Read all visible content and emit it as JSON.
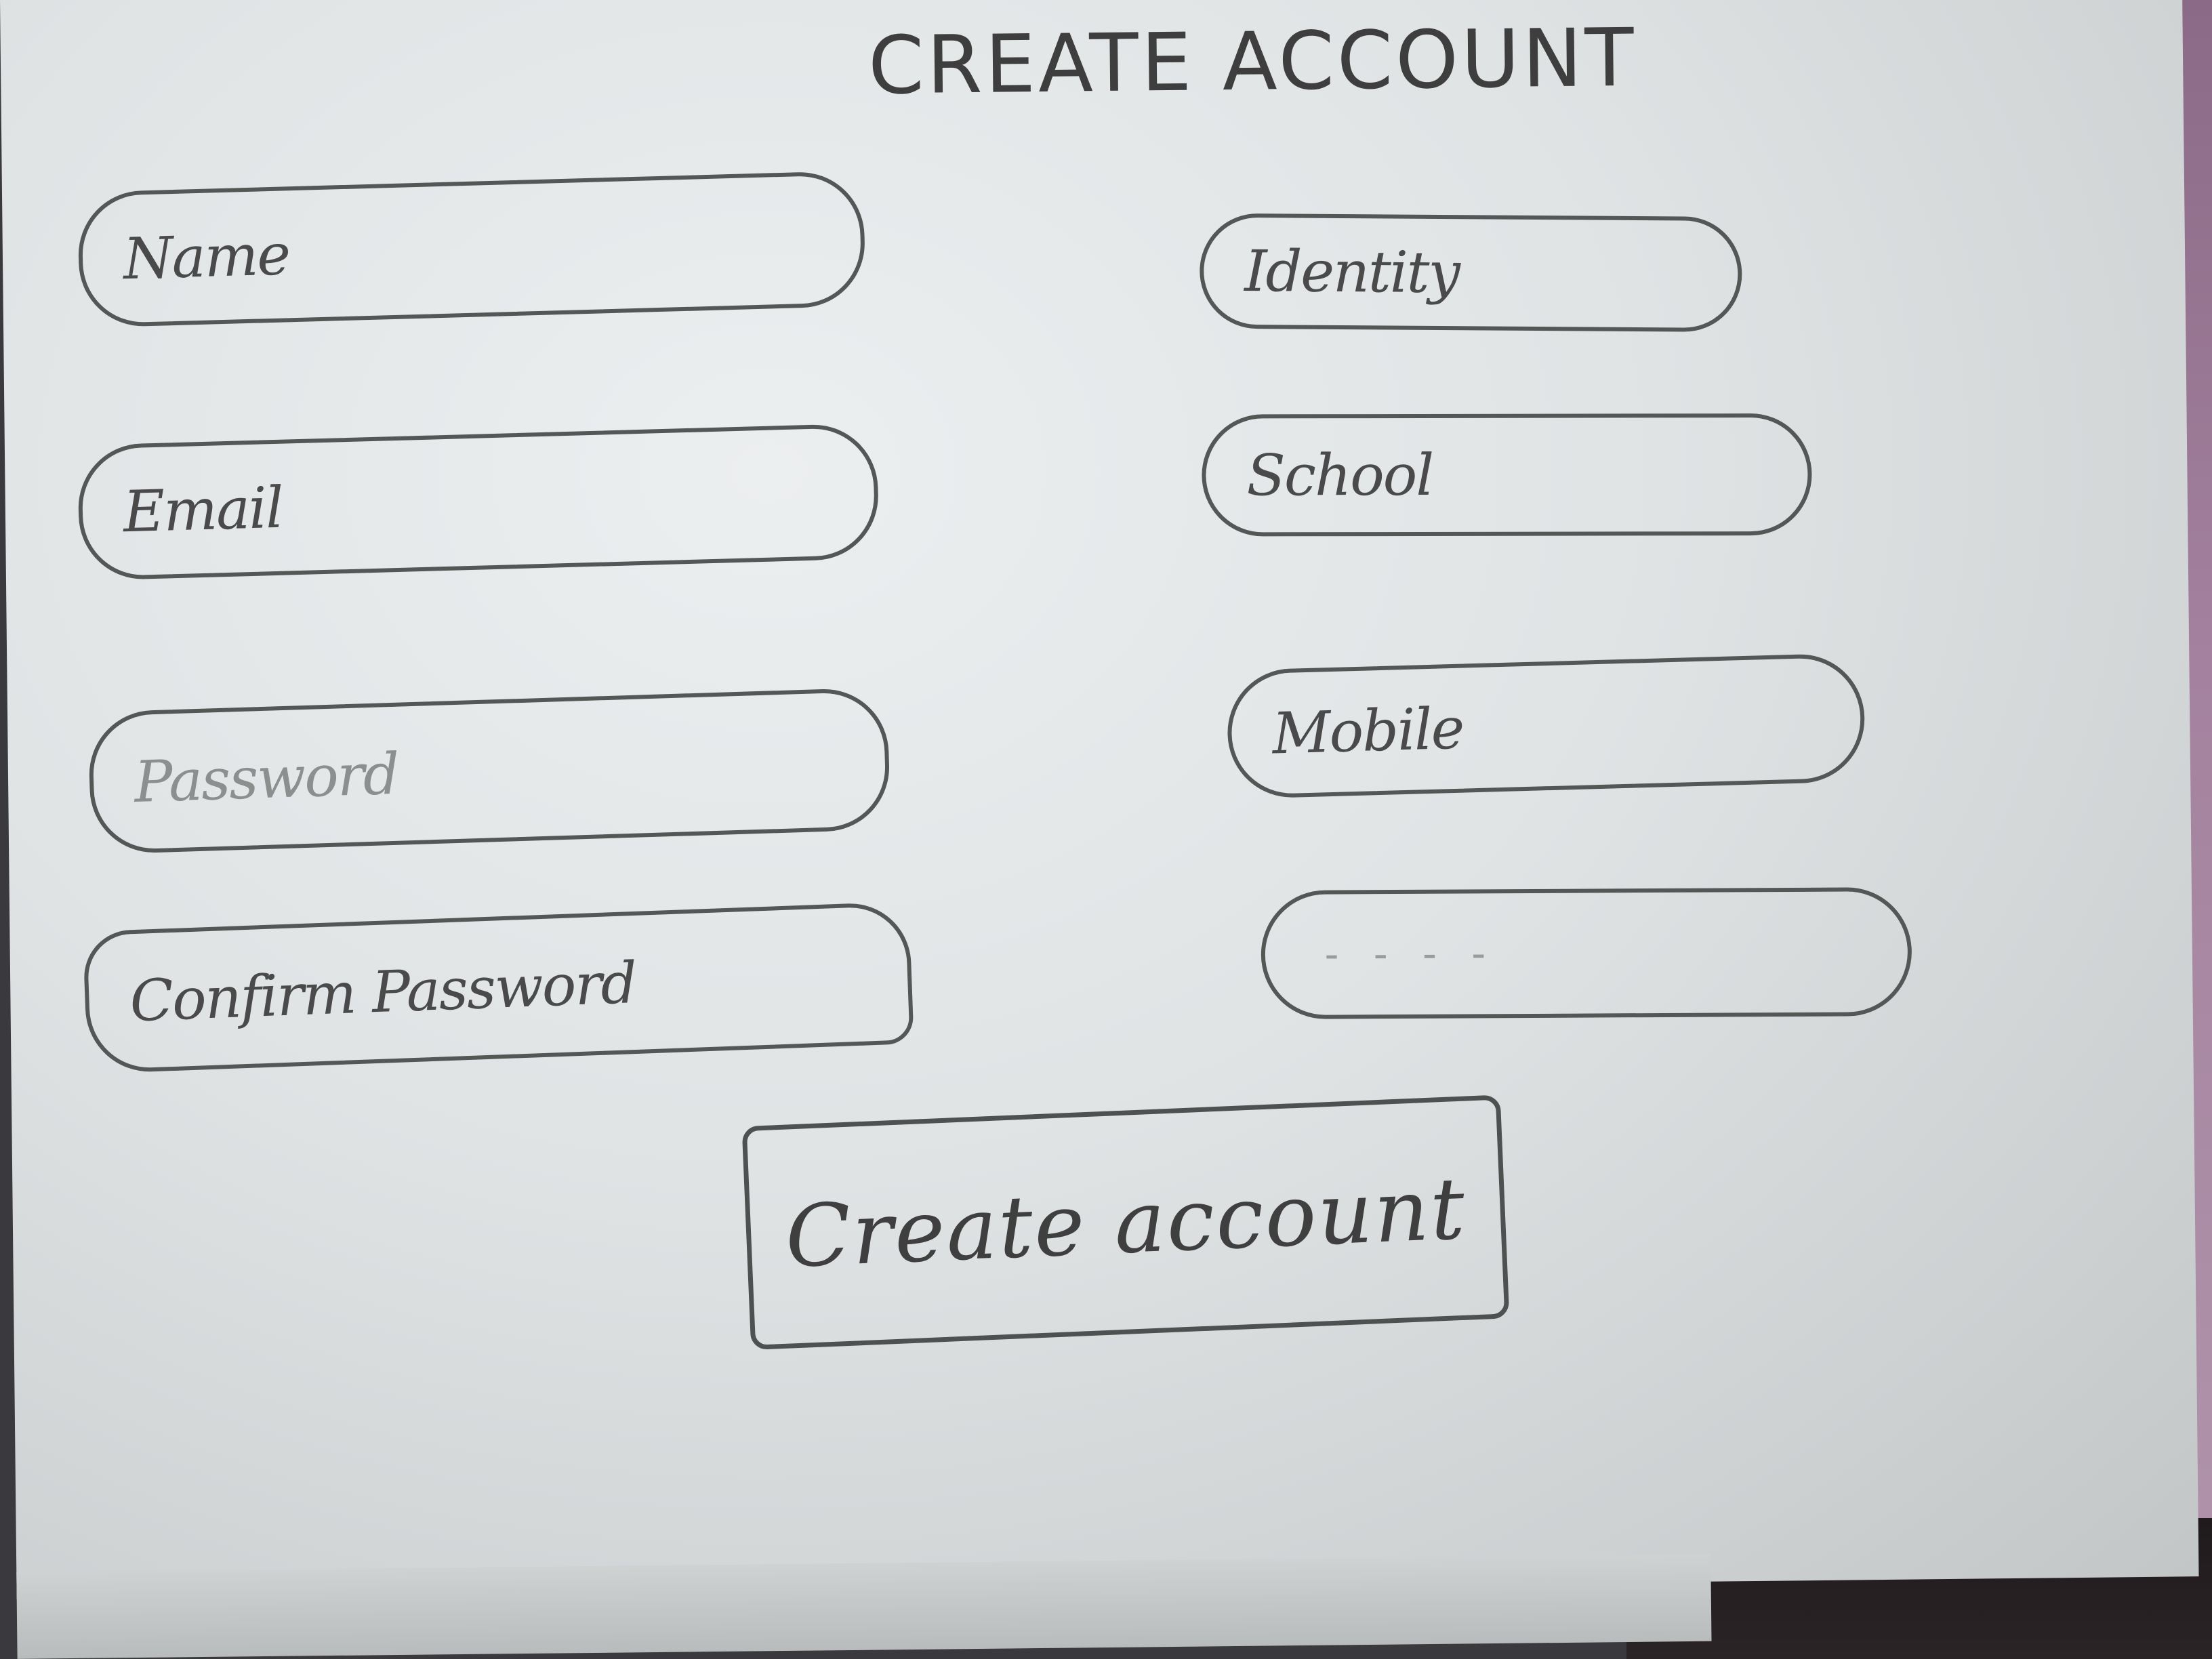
{
  "page": {
    "title": "CREATE ACCOUNT"
  },
  "form": {
    "left_fields": [
      {
        "label": "Name"
      },
      {
        "label": "Email"
      },
      {
        "label": "Password"
      },
      {
        "label": "Confirm Password"
      }
    ],
    "right_fields": [
      {
        "label": "Identity"
      },
      {
        "label": "School"
      },
      {
        "label": "Mobile"
      },
      {
        "placeholder": "- - - -"
      }
    ],
    "submit_label": "Create account"
  },
  "colors": {
    "paper": "#e2e5e6",
    "ink": "#4a4a4a"
  }
}
